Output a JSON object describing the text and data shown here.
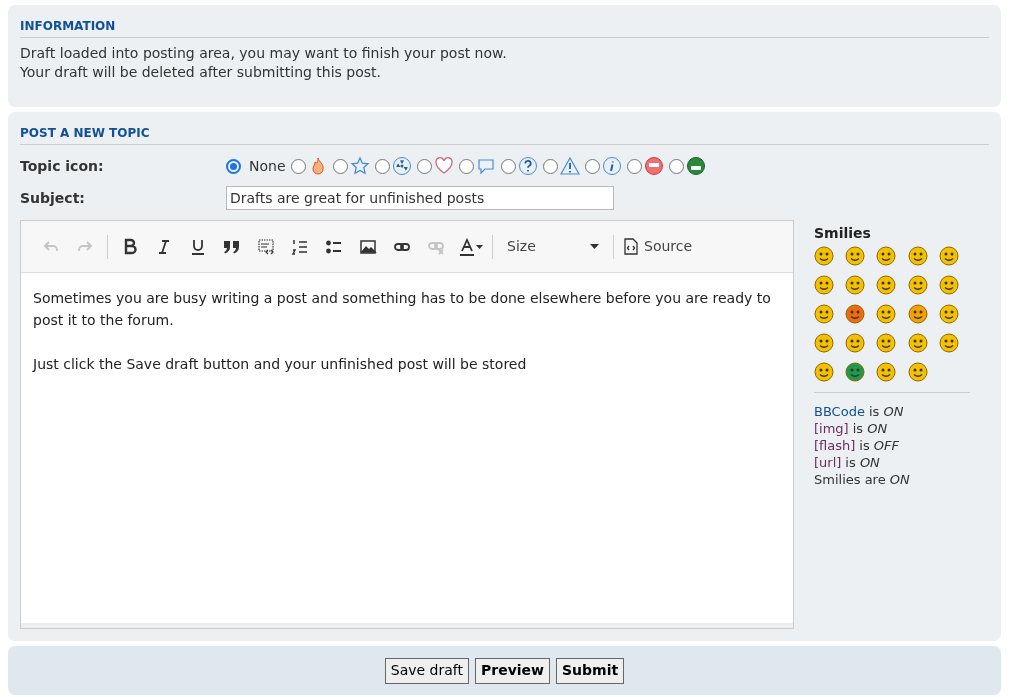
{
  "information": {
    "heading": "INFORMATION",
    "lines": [
      "Draft loaded into posting area, you may want to finish your post now.",
      "Your draft will be deleted after submitting this post."
    ]
  },
  "post_form": {
    "heading": "POST A NEW TOPIC",
    "topic_icon": {
      "label": "Topic icon:",
      "options": [
        {
          "kind": "none",
          "label": "None",
          "selected": true
        },
        {
          "kind": "fire",
          "selected": false
        },
        {
          "kind": "star",
          "selected": false
        },
        {
          "kind": "radioactive",
          "selected": false
        },
        {
          "kind": "heart",
          "selected": false
        },
        {
          "kind": "speech",
          "selected": false
        },
        {
          "kind": "question",
          "selected": false
        },
        {
          "kind": "warning",
          "selected": false
        },
        {
          "kind": "info",
          "selected": false
        },
        {
          "kind": "red-face",
          "selected": false
        },
        {
          "kind": "green-face",
          "selected": false
        }
      ]
    },
    "subject": {
      "label": "Subject:",
      "value": "Drafts are great for unfinished posts"
    },
    "toolbar": [
      {
        "kind": "undo",
        "disabled": true
      },
      {
        "kind": "redo",
        "disabled": true
      },
      {
        "kind": "separator"
      },
      {
        "kind": "bold",
        "disabled": false
      },
      {
        "kind": "italic",
        "disabled": false
      },
      {
        "kind": "underline",
        "disabled": false
      },
      {
        "kind": "quote",
        "disabled": false
      },
      {
        "kind": "code",
        "disabled": false
      },
      {
        "kind": "ordered-list",
        "disabled": false
      },
      {
        "kind": "bullet-list",
        "disabled": false
      },
      {
        "kind": "image",
        "disabled": false
      },
      {
        "kind": "link",
        "disabled": false
      },
      {
        "kind": "unlink",
        "disabled": true
      },
      {
        "kind": "text-color",
        "disabled": false
      },
      {
        "kind": "separator"
      },
      {
        "kind": "size",
        "label": "Size"
      },
      {
        "kind": "separator"
      },
      {
        "kind": "source",
        "label": "Source"
      }
    ],
    "editor_paragraphs": [
      "Sometimes you are busy writing a post and something has to be done elsewhere before you are ready to post it to the forum.",
      "Just click the Save draft button and your unfinished post will be stored"
    ],
    "smilies": {
      "heading": "Smilies",
      "items": [
        {
          "color": "#f5c000"
        },
        {
          "color": "#f5c000"
        },
        {
          "color": "#f5c000"
        },
        {
          "color": "#f5c000"
        },
        {
          "color": "#f5c000"
        },
        {
          "color": "#f5c000"
        },
        {
          "color": "#f5c000"
        },
        {
          "color": "#f5c000"
        },
        {
          "color": "#f5c000"
        },
        {
          "color": "#f5c000"
        },
        {
          "color": "#f5c000"
        },
        {
          "color": "#f06a10"
        },
        {
          "color": "#f5c000"
        },
        {
          "color": "#f5a000"
        },
        {
          "color": "#f5c000"
        },
        {
          "color": "#f5c000"
        },
        {
          "color": "#f5c000"
        },
        {
          "color": "#f5c000"
        },
        {
          "color": "#f5c000"
        },
        {
          "color": "#f5c000"
        },
        {
          "color": "#f5c000"
        },
        {
          "color": "#1e9a4a"
        },
        {
          "color": "#f5c000"
        },
        {
          "color": "#f5c000"
        }
      ]
    },
    "status_lines": [
      {
        "link": "BBCode",
        "visited": false,
        "text": "is *ON*"
      },
      {
        "link": "[img]",
        "visited": true,
        "text": "is *ON*"
      },
      {
        "link": "[flash]",
        "visited": true,
        "text": "is *OFF*"
      },
      {
        "link": "[url]",
        "visited": true,
        "text": "is *ON*"
      },
      {
        "text": "Smilies are *ON*"
      }
    ]
  },
  "buttons": [
    {
      "label": "Save draft",
      "bold": false
    },
    {
      "label": "Preview",
      "bold": true
    },
    {
      "label": "Submit",
      "bold": true
    }
  ]
}
